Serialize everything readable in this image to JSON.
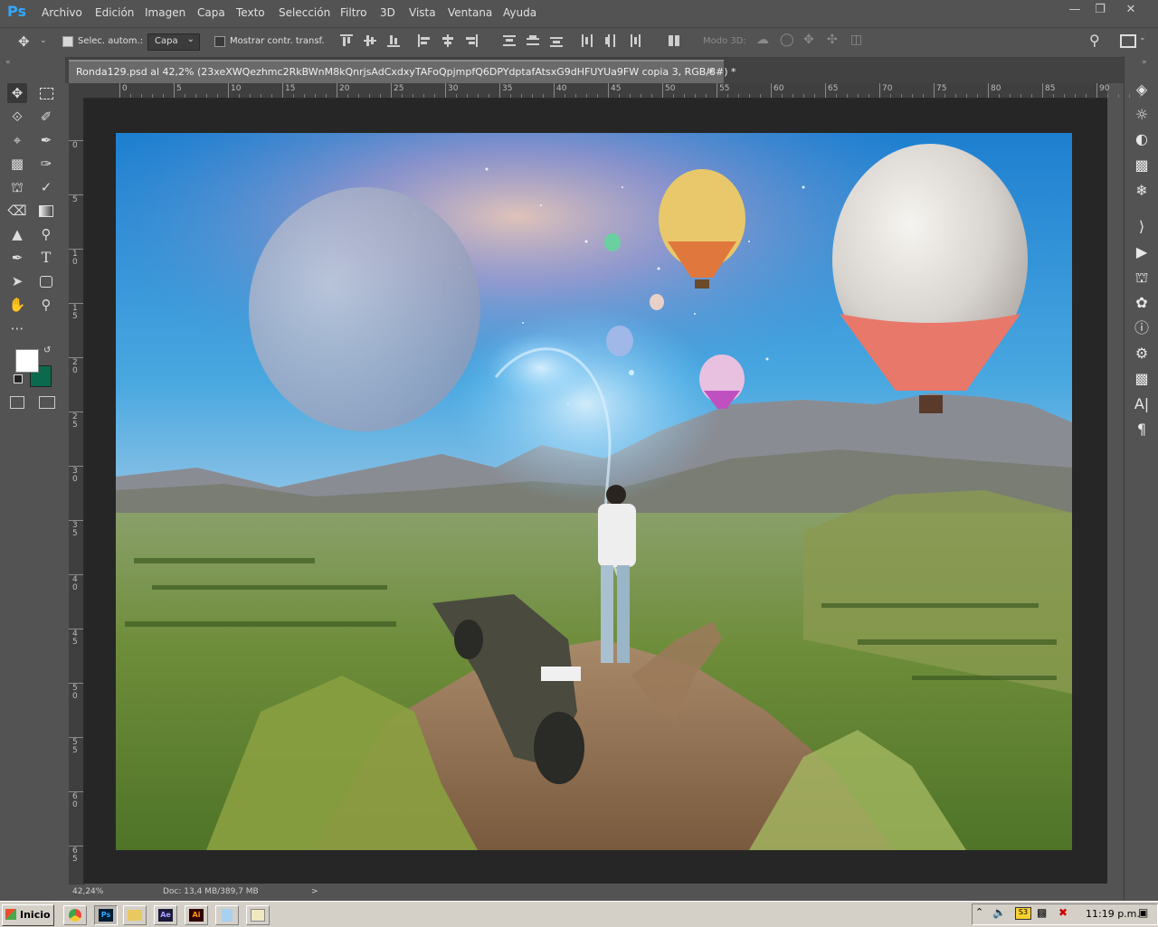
{
  "app": {
    "logo": "Ps"
  },
  "menu": [
    "Archivo",
    "Edición",
    "Imagen",
    "Capa",
    "Texto",
    "Selección",
    "Filtro",
    "3D",
    "Vista",
    "Ventana",
    "Ayuda"
  ],
  "options": {
    "auto_select_label": "Selec. autom.:",
    "auto_select_value": "Capa",
    "show_transform_label": "Mostrar contr. transf.",
    "mode3d_label": "Modo 3D:"
  },
  "document": {
    "tab_title": "Ronda129.psd al 42,2% (23xeXWQezhmc2RkBWnM8kQnrjsAdCxdxyTAFoQpjmpfQ6DPYdptafAtsxG9dHFUYUa9FW copia 3, RGB/8#) *",
    "close": "×"
  },
  "ruler_h": [
    "0",
    "5",
    "10",
    "15",
    "20",
    "25",
    "30",
    "35",
    "40",
    "45",
    "50",
    "55",
    "60",
    "65",
    "70",
    "75",
    "80",
    "85",
    "90"
  ],
  "ruler_v": [
    "0",
    "5",
    "1 0",
    "1 5",
    "2 0",
    "2 5",
    "3 0",
    "3 5",
    "4 0",
    "4 5",
    "5 0",
    "5 5",
    "6 0",
    "6 5"
  ],
  "status": {
    "zoom": "42,24%",
    "doc_size": "Doc: 13,4 MB/389,7 MB",
    "arrow": ">"
  },
  "taskbar": {
    "start_label": "Inicio",
    "apps": [
      "Chrome",
      "Ps",
      "Explorer",
      "Ae",
      "Ai",
      "Notepad",
      "Paint"
    ],
    "clock": "11:19 p.m."
  },
  "colors": {
    "foreground": "#ffffff",
    "background": "#0b6a4d",
    "ps_blue": "#31a8ff"
  },
  "icons": {
    "tools": [
      "move-icon",
      "marquee-icon",
      "lasso-icon",
      "quick-select-icon",
      "crop-icon",
      "eyedropper-icon",
      "healing-brush-icon",
      "brush-icon",
      "clone-stamp-icon",
      "history-brush-icon",
      "eraser-icon",
      "gradient-icon",
      "blur-icon",
      "dodge-icon",
      "pen-icon",
      "type-icon",
      "path-select-icon",
      "shape-icon",
      "hand-icon",
      "zoom-icon",
      "more-tools-icon"
    ],
    "right_panel": [
      "layers-icon",
      "libraries-icon",
      "adjustments-icon",
      "histogram-icon",
      "navigator-icon",
      "paths-icon",
      "actions-icon",
      "clone-source-icon",
      "color-icon",
      "info-icon",
      "properties-icon",
      "3d-icon",
      "character-icon",
      "paragraph-icon"
    ]
  }
}
